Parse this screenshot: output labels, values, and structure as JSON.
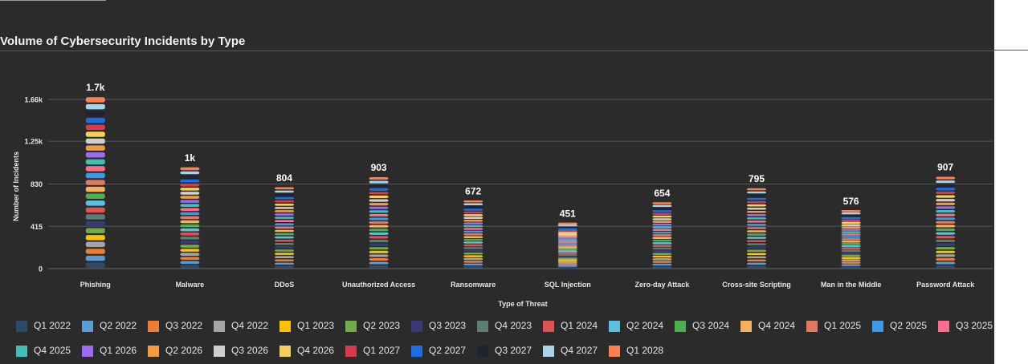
{
  "title": "Volume of Cybersecurity Incidents by Type",
  "chart_data": {
    "type": "bar",
    "stacked": true,
    "title": "Volume of Cybersecurity Incidents by Type",
    "xlabel": "Type of Threat",
    "ylabel": "Number of Incidents",
    "ylim": [
      0,
      1690
    ],
    "yticks": [
      0,
      415,
      830,
      1250,
      1660
    ],
    "ytick_labels": [
      "0",
      "415",
      "830",
      "1.25k",
      "1.66k"
    ],
    "grid": true,
    "legend_position": "bottom",
    "categories": [
      "Phishing",
      "Malware",
      "DDoS",
      "Unauthorized Access",
      "Ransomware",
      "SQL Injection",
      "Zero-day Attack",
      "Cross-site Scripting",
      "Man in the Middle",
      "Password Attack"
    ],
    "totals": [
      1690,
      1000,
      804,
      903,
      672,
      451,
      654,
      795,
      576,
      907
    ],
    "total_labels": [
      "1.7k",
      "1k",
      "804",
      "903",
      "672",
      "451",
      "654",
      "795",
      "576",
      "907"
    ],
    "series": [
      {
        "name": "Q1 2022",
        "color": "#2e4a6b"
      },
      {
        "name": "Q2 2022",
        "color": "#5b9bd5"
      },
      {
        "name": "Q3 2022",
        "color": "#ed7d31"
      },
      {
        "name": "Q4 2022",
        "color": "#a5a5a5"
      },
      {
        "name": "Q1 2023",
        "color": "#ffc000"
      },
      {
        "name": "Q2 2023",
        "color": "#70ad47"
      },
      {
        "name": "Q3 2023",
        "color": "#3a3a78"
      },
      {
        "name": "Q4 2023",
        "color": "#5a7f72"
      },
      {
        "name": "Q1 2024",
        "color": "#e05252"
      },
      {
        "name": "Q2 2024",
        "color": "#5bc0de"
      },
      {
        "name": "Q3 2024",
        "color": "#4caf50"
      },
      {
        "name": "Q4 2024",
        "color": "#f4b05a"
      },
      {
        "name": "Q1 2025",
        "color": "#e07a5f"
      },
      {
        "name": "Q2 2025",
        "color": "#3b9be8"
      },
      {
        "name": "Q3 2025",
        "color": "#ff6b8b"
      },
      {
        "name": "Q4 2025",
        "color": "#3fbfb5"
      },
      {
        "name": "Q1 2026",
        "color": "#9b6bf0"
      },
      {
        "name": "Q2 2026",
        "color": "#f59b3f"
      },
      {
        "name": "Q3 2026",
        "color": "#cfcfcf"
      },
      {
        "name": "Q4 2026",
        "color": "#f7cf5b"
      },
      {
        "name": "Q1 2027",
        "color": "#d93a4a"
      },
      {
        "name": "Q2 2027",
        "color": "#1a6fe8"
      },
      {
        "name": "Q3 2027",
        "color": "#1e2430"
      },
      {
        "name": "Q4 2027",
        "color": "#a9d3e8"
      },
      {
        "name": "Q1 2028",
        "color": "#ff7f50"
      }
    ]
  }
}
